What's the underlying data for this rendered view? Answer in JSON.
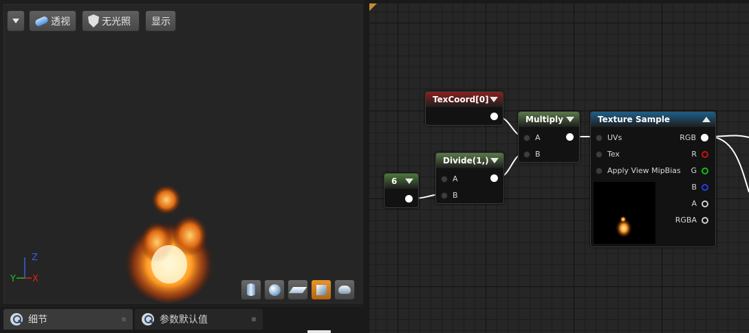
{
  "viewport": {
    "toolbar": {
      "perspective_label": "透视",
      "lighting_label": "无光照",
      "show_label": "显示"
    },
    "axis": {
      "x": "X",
      "y": "Y",
      "z": "Z"
    },
    "preview_shapes": [
      "cylinder-icon",
      "sphere-icon",
      "plane-icon",
      "cube-icon",
      "teapot-icon"
    ],
    "active_preview_shape": "cube-icon"
  },
  "panel_tabs": [
    {
      "label": "细节",
      "icon": "info-icon",
      "active": true
    },
    {
      "label": "参数默认值",
      "icon": "info-icon",
      "active": false
    }
  ],
  "graph": {
    "colors": {
      "texcoord_header": "#8a1f1f",
      "math_header": "#5a7a4a",
      "constant_header": "#4a7a3a",
      "texture_header": "#1d5f8a",
      "accent_corner": "#c98d2b"
    },
    "nodes": {
      "texcoord": {
        "title": "TexCoord[0]"
      },
      "constant": {
        "title": "6"
      },
      "divide": {
        "title": "Divide(1,)",
        "inputs": [
          "A",
          "B"
        ]
      },
      "multiply": {
        "title": "Multiply",
        "inputs": [
          "A",
          "B"
        ]
      },
      "texture_sample": {
        "title": "Texture Sample",
        "inputs": [
          "UVs",
          "Tex",
          "Apply View MipBias"
        ],
        "outputs": [
          "RGB",
          "R",
          "G",
          "B",
          "A",
          "RGBA"
        ],
        "output_colors": [
          "#ffffff",
          "#d01010",
          "#10c010",
          "#2040e0",
          "#d0d0d0",
          "#d0d0d0"
        ]
      }
    }
  }
}
